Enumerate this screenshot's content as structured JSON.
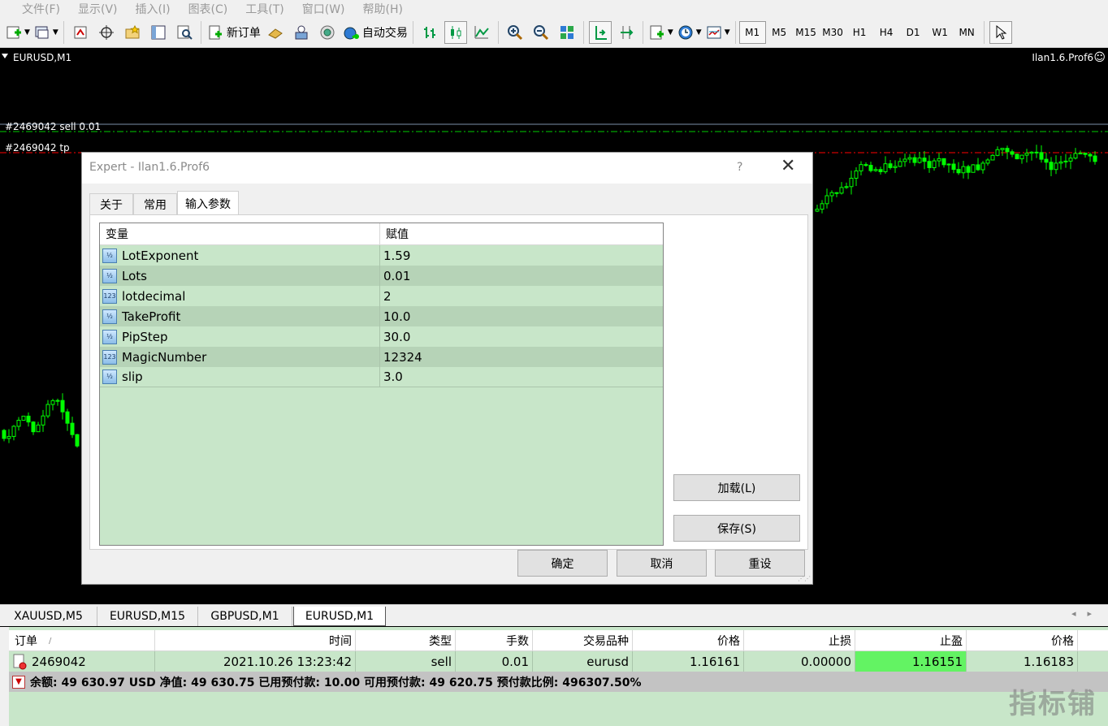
{
  "menu": [
    "文件(F)",
    "显示(V)",
    "插入(I)",
    "图表(C)",
    "工具(T)",
    "窗口(W)",
    "帮助(H)"
  ],
  "toolbar": {
    "new_order": "新订单",
    "auto_trading": "自动交易",
    "timeframes": [
      "M1",
      "M5",
      "M15",
      "M30",
      "H1",
      "H4",
      "D1",
      "W1",
      "MN"
    ],
    "active_timeframe": "M1"
  },
  "chart": {
    "title": "EURUSD,M1",
    "expert_name": "Ilan1.6.Prof6",
    "smiley": "☺",
    "order_line_label": "#2469042 sell 0.01",
    "tp_line_label": "#2469042 tp",
    "colors": {
      "background": "#000000",
      "candle": "#00ff00",
      "order_line": "#00cc00",
      "tp_line": "#ff0000"
    }
  },
  "dialog": {
    "title": "Expert - Ilan1.6.Prof6",
    "help": "?",
    "close": "✕",
    "tabs": [
      "关于",
      "常用",
      "输入参数"
    ],
    "active_tab": "输入参数",
    "columns": {
      "variable": "变量",
      "value": "赋值"
    },
    "params": [
      {
        "name": "LotExponent",
        "value": "1.59",
        "icon": "½"
      },
      {
        "name": "Lots",
        "value": "0.01",
        "icon": "½"
      },
      {
        "name": "lotdecimal",
        "value": "2",
        "icon": "123"
      },
      {
        "name": "TakeProfit",
        "value": "10.0",
        "icon": "½"
      },
      {
        "name": "PipStep",
        "value": "30.0",
        "icon": "½"
      },
      {
        "name": "MagicNumber",
        "value": "12324",
        "icon": "123"
      },
      {
        "name": "slip",
        "value": "3.0",
        "icon": "½"
      }
    ],
    "load_button": "加载(L)",
    "save_button": "保存(S)",
    "ok_button": "确定",
    "cancel_button": "取消",
    "reset_button": "重设"
  },
  "chart_tabs": [
    "XAUUSD,M5",
    "EURUSD,M15",
    "GBPUSD,M1",
    "EURUSD,M1"
  ],
  "active_chart_tab": "EURUSD,M1",
  "terminal": {
    "columns": [
      "订单",
      "时间",
      "类型",
      "手数",
      "交易品种",
      "价格",
      "止损",
      "止盈",
      "价格"
    ],
    "sort_marker": "/",
    "order": {
      "ticket": "2469042",
      "time": "2021.10.26 13:23:42",
      "type": "sell",
      "lots": "0.01",
      "symbol": "eurusd",
      "open_price": "1.16161",
      "sl": "0.00000",
      "tp": "1.16151",
      "current_price": "1.16183"
    },
    "balance_line": "余额: 49 630.97 USD  净值: 49 630.75  已用预付款: 10.00  可用预付款: 49 620.75  预付款比例: 496307.50%"
  },
  "watermark": "指标铺"
}
